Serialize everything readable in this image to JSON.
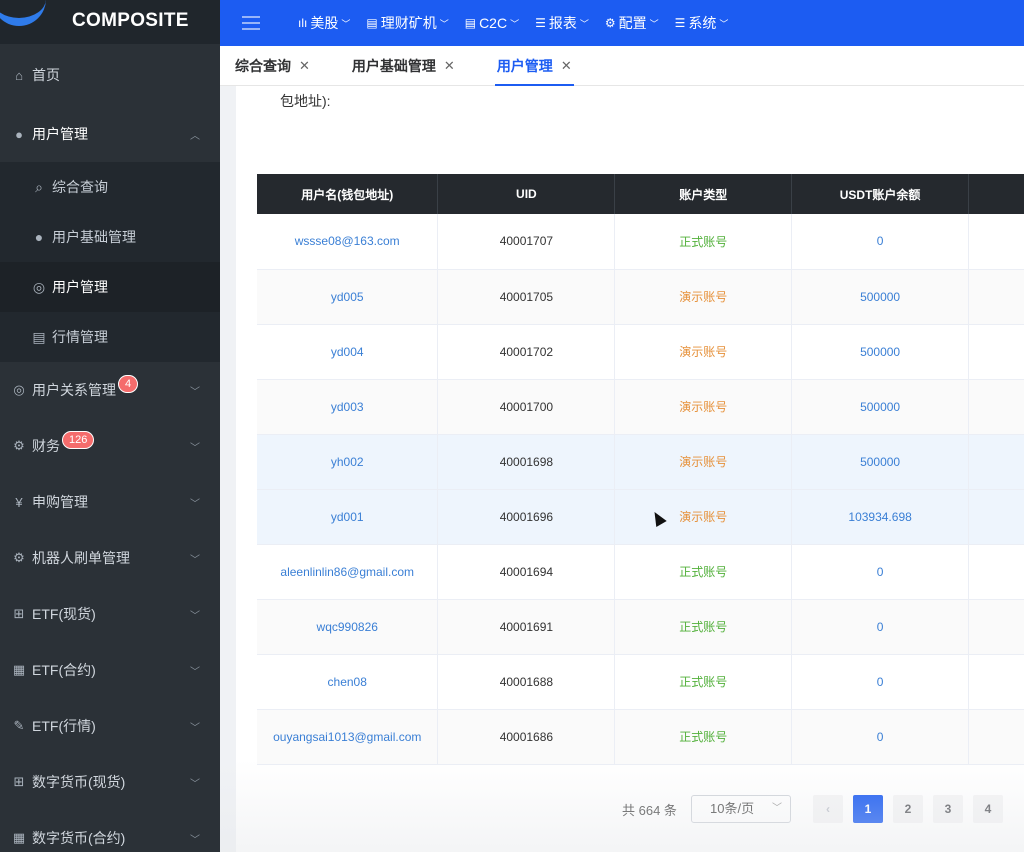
{
  "brand": {
    "name": "COMPOSITE"
  },
  "sidebar": {
    "items": [
      {
        "label": "首页",
        "icon": "home-icon"
      },
      {
        "label": "用户管理",
        "icon": "user-icon",
        "open": true,
        "children": [
          {
            "label": "综合查询",
            "icon": "search-icon"
          },
          {
            "label": "用户基础管理",
            "icon": "user-icon"
          },
          {
            "label": "用户管理",
            "icon": "user-circle-icon",
            "active": true
          },
          {
            "label": "行情管理",
            "icon": "list-icon"
          }
        ]
      },
      {
        "label": "用户关系管理",
        "icon": "user-circle-icon",
        "badge": "4"
      },
      {
        "label": "财务",
        "icon": "gear-icon",
        "badge": "126"
      },
      {
        "label": "申购管理",
        "icon": "yen-icon"
      },
      {
        "label": "机器人刷单管理",
        "icon": "gear-icon"
      },
      {
        "label": "ETF(现货)",
        "icon": "shop-icon"
      },
      {
        "label": "ETF(合约)",
        "icon": "document-icon"
      },
      {
        "label": "ETF(行情)",
        "icon": "edit-icon"
      },
      {
        "label": "数字货币(现货)",
        "icon": "shop-icon"
      },
      {
        "label": "数字货币(合约)",
        "icon": "document-icon"
      }
    ]
  },
  "topnav": {
    "items": [
      {
        "label": "美股",
        "icon": "bar-chart-icon"
      },
      {
        "label": "理财矿机",
        "icon": "list-icon"
      },
      {
        "label": "C2C",
        "icon": "list-icon"
      },
      {
        "label": "报表",
        "icon": "menu-icon"
      },
      {
        "label": "配置",
        "icon": "gear-icon"
      },
      {
        "label": "系统",
        "icon": "menu-icon"
      }
    ]
  },
  "tabs": [
    {
      "label": "综合查询"
    },
    {
      "label": "用户基础管理"
    },
    {
      "label": "用户管理",
      "active": true
    }
  ],
  "filter": {
    "label": "包地址):"
  },
  "table": {
    "headers": [
      "用户名(钱包地址)",
      "UID",
      "账户类型",
      "USDT账户余额",
      ""
    ],
    "rows": [
      {
        "user": "wssse08@163.com",
        "uid": "40001707",
        "type": "正式账号",
        "kind": "formal",
        "balance": "0"
      },
      {
        "user": "yd005",
        "uid": "40001705",
        "type": "演示账号",
        "kind": "demo",
        "balance": "500000"
      },
      {
        "user": "yd004",
        "uid": "40001702",
        "type": "演示账号",
        "kind": "demo",
        "balance": "500000"
      },
      {
        "user": "yd003",
        "uid": "40001700",
        "type": "演示账号",
        "kind": "demo",
        "balance": "500000"
      },
      {
        "user": "yh002",
        "uid": "40001698",
        "type": "演示账号",
        "kind": "demo",
        "balance": "500000"
      },
      {
        "user": "yd001",
        "uid": "40001696",
        "type": "演示账号",
        "kind": "demo",
        "balance": "103934.698"
      },
      {
        "user": "aleenlinlin86@gmail.com",
        "uid": "40001694",
        "type": "正式账号",
        "kind": "formal",
        "balance": "0"
      },
      {
        "user": "wqc990826",
        "uid": "40001691",
        "type": "正式账号",
        "kind": "formal",
        "balance": "0"
      },
      {
        "user": "chen08",
        "uid": "40001688",
        "type": "正式账号",
        "kind": "formal",
        "balance": "0"
      },
      {
        "user": "ouyangsai1013@gmail.com",
        "uid": "40001686",
        "type": "正式账号",
        "kind": "formal",
        "balance": "0"
      }
    ]
  },
  "pagination": {
    "total": "共 664 条",
    "page_size": "10条/页",
    "prev": "‹",
    "pages": [
      "1",
      "2",
      "3",
      "4"
    ],
    "current": "1"
  },
  "colors": {
    "primary": "#1c5cf2",
    "sidebar_bg": "#2b3137",
    "formal": "#52b03a",
    "demo": "#e6913a",
    "link": "#3a7fd5",
    "badge": "#f56c6c"
  }
}
